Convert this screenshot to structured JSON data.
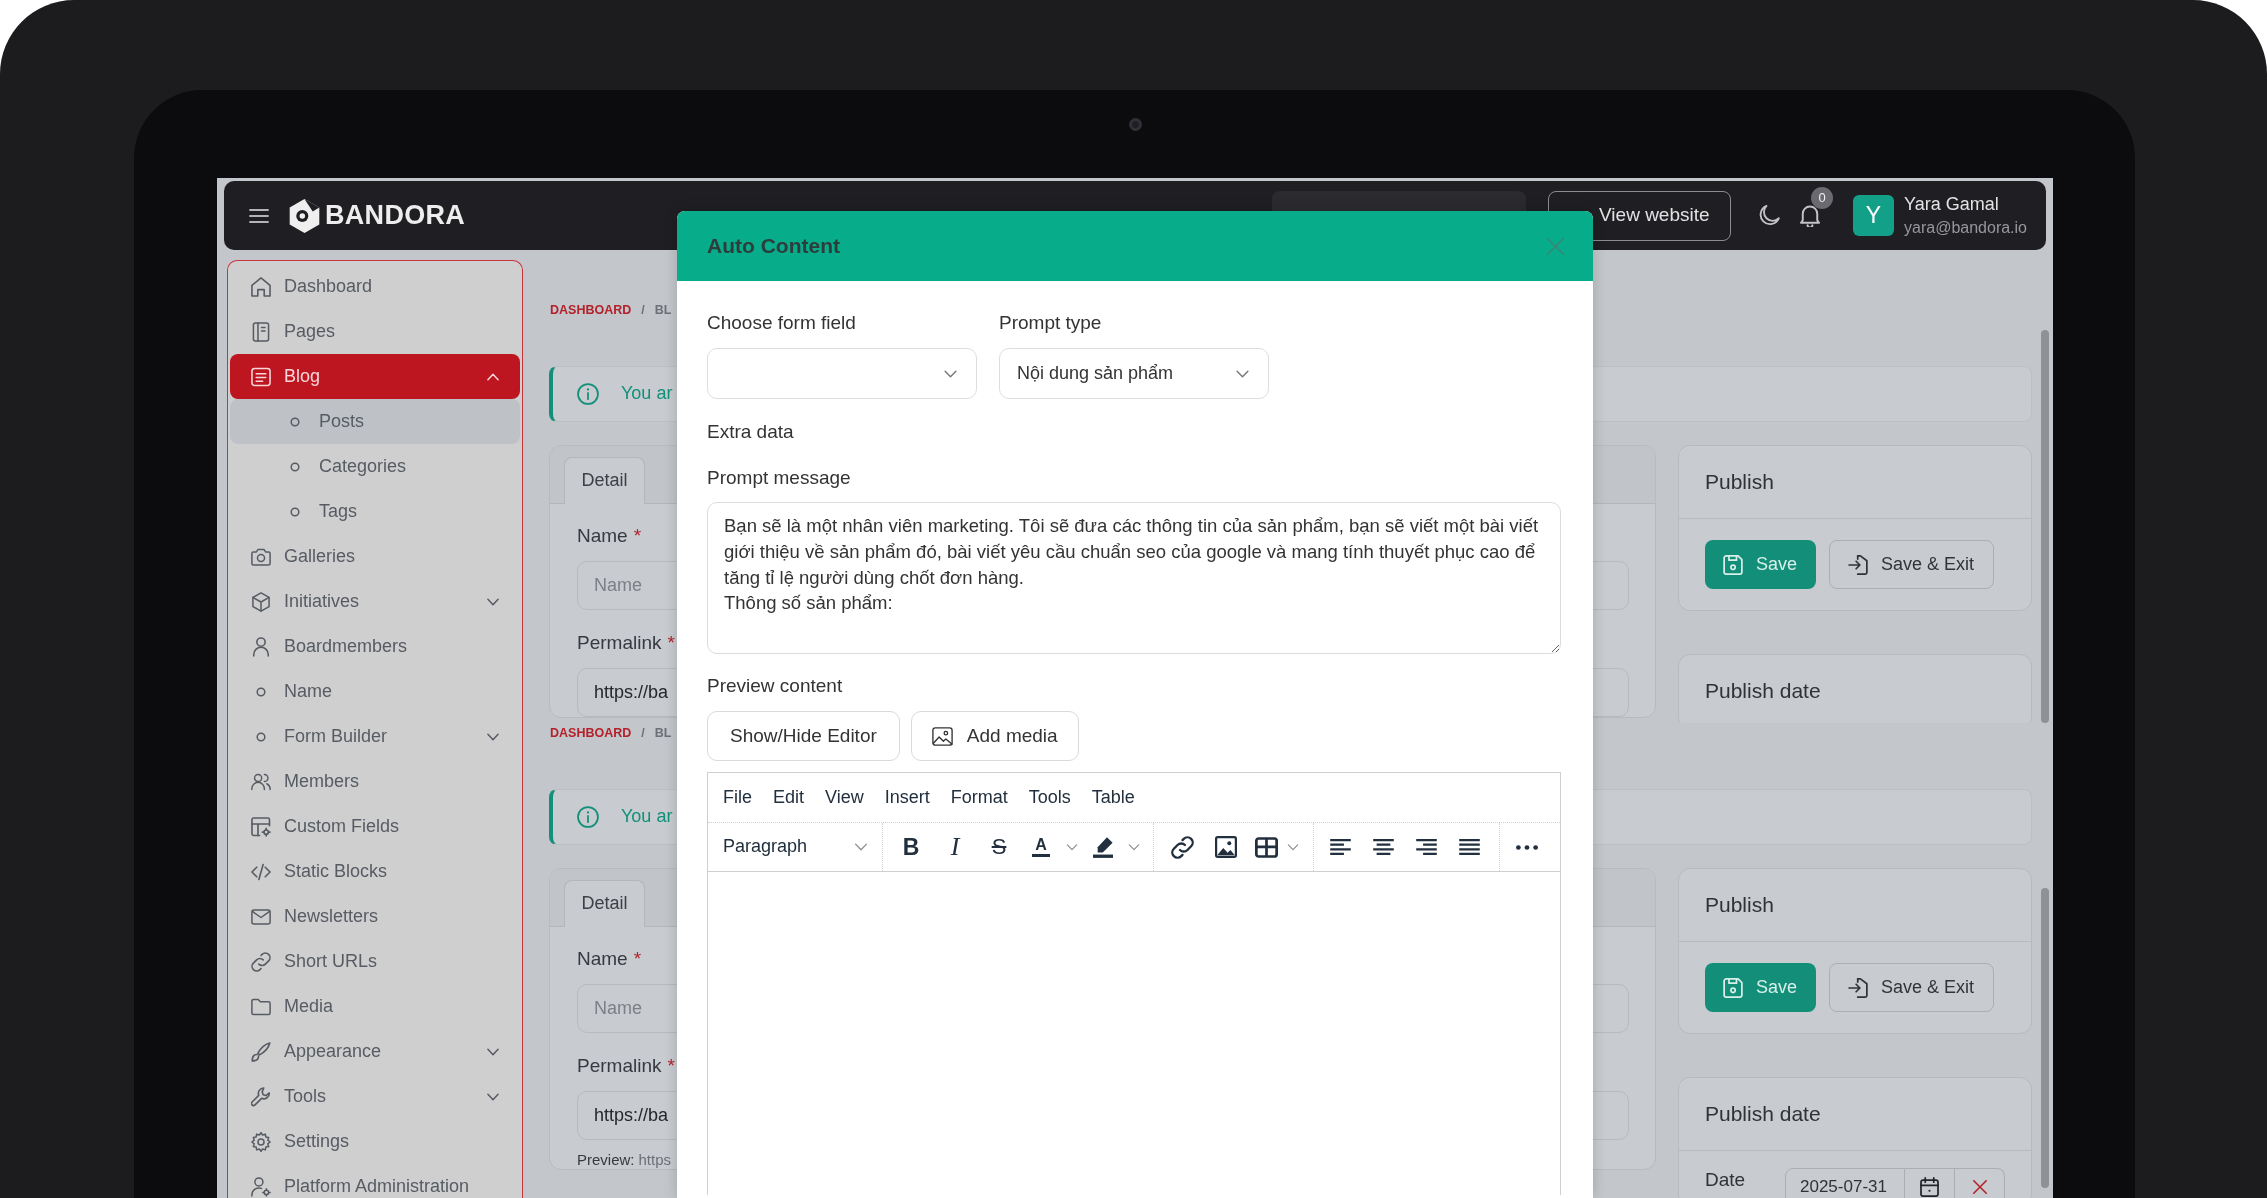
{
  "navbar": {
    "brand": "BANDORA",
    "view_website": "View website",
    "notifications": {
      "count": "0"
    },
    "user": {
      "initial": "Y",
      "name": "Yara Gamal",
      "email": "yara@bandora.io"
    }
  },
  "sidebar": {
    "items": [
      {
        "label": "Dashboard",
        "kind": "link",
        "selected": false
      },
      {
        "label": "Pages",
        "kind": "link",
        "selected": false
      },
      {
        "label": "Blog",
        "kind": "group",
        "selected": true,
        "expanded": true,
        "children": [
          {
            "label": "Posts",
            "selected": true
          },
          {
            "label": "Categories",
            "selected": false
          },
          {
            "label": "Tags",
            "selected": false
          }
        ]
      },
      {
        "label": "Galleries",
        "kind": "link",
        "selected": false
      },
      {
        "label": "Initiatives",
        "kind": "group",
        "selected": false,
        "expanded": false
      },
      {
        "label": "Boardmembers",
        "kind": "link",
        "selected": false
      },
      {
        "label": "Name",
        "kind": "link",
        "selected": false
      },
      {
        "label": "Form Builder",
        "kind": "group",
        "selected": false,
        "expanded": false
      },
      {
        "label": "Members",
        "kind": "link",
        "selected": false
      },
      {
        "label": "Custom Fields",
        "kind": "link",
        "selected": false
      },
      {
        "label": "Static Blocks",
        "kind": "link",
        "selected": false
      },
      {
        "label": "Newsletters",
        "kind": "link",
        "selected": false
      },
      {
        "label": "Short URLs",
        "kind": "link",
        "selected": false
      },
      {
        "label": "Media",
        "kind": "link",
        "selected": false
      },
      {
        "label": "Appearance",
        "kind": "group",
        "selected": false,
        "expanded": false
      },
      {
        "label": "Tools",
        "kind": "group",
        "selected": false,
        "expanded": false
      },
      {
        "label": "Settings",
        "kind": "link",
        "selected": false
      },
      {
        "label": "Platform Administration",
        "kind": "link",
        "selected": false
      }
    ]
  },
  "page_copies": [
    {
      "breadcrumb": {
        "separator": "/",
        "items": [
          {
            "label": "DASHBOARD",
            "kind": "link"
          },
          {
            "label": "BL",
            "kind": "current"
          }
        ]
      },
      "alert": {
        "text": "You ar"
      },
      "tabs": [
        {
          "label": "Detail",
          "selected": true
        }
      ],
      "fields": [
        {
          "label": "Name",
          "required": true,
          "required_mark": "*",
          "placeholder": "Name"
        },
        {
          "label": "Permalink",
          "required": true,
          "required_mark": "*",
          "value": "https://ba"
        }
      ],
      "publish": {
        "title": "Publish",
        "buttons": [
          {
            "label": "Save",
            "kind": "primary"
          },
          {
            "label": "Save & Exit",
            "kind": "secondary"
          }
        ]
      },
      "publish_date": {
        "title": "Publish date"
      }
    },
    {
      "breadcrumb": {
        "separator": "/",
        "items": [
          {
            "label": "DASHBOARD",
            "kind": "link"
          },
          {
            "label": "BL",
            "kind": "current"
          }
        ]
      },
      "alert": {
        "text": "You ar"
      },
      "tabs": [
        {
          "label": "Detail",
          "selected": true
        }
      ],
      "fields": [
        {
          "label": "Name",
          "required": true,
          "required_mark": "*",
          "placeholder": "Name"
        },
        {
          "label": "Permalink",
          "required": true,
          "required_mark": "*",
          "value": "https://ba",
          "preview": {
            "label": "Preview:",
            "url": "https"
          }
        }
      ],
      "publish": {
        "title": "Publish",
        "buttons": [
          {
            "label": "Save",
            "kind": "primary"
          },
          {
            "label": "Save & Exit",
            "kind": "secondary"
          }
        ]
      },
      "publish_date": {
        "title": "Publish date",
        "date": {
          "label": "Date",
          "value": "2025-07-31"
        }
      }
    }
  ],
  "modal": {
    "title": "Auto Content",
    "selects": [
      {
        "label": "Choose form field"
      },
      {
        "label": "Prompt type",
        "value": "Nội dung sản phẩm"
      }
    ],
    "extra_data": {
      "label": "Extra data"
    },
    "prompt": {
      "label": "Prompt message",
      "value": "Bạn sẽ là một nhân viên marketing. Tôi sẽ đưa các thông tin của sản phẩm, bạn sẽ viết một bài viết giới thiệu về sản phẩm đó, bài viết yêu cầu chuẩn seo của google và mang tính thuyết phục cao để tăng tỉ lệ người dùng chốt đơn hàng.\nThông số sản phẩm:"
    },
    "preview": {
      "label": "Preview content",
      "buttons": [
        {
          "label": "Show/Hide Editor",
          "kind": "plain"
        },
        {
          "label": "Add media",
          "kind": "media"
        }
      ]
    },
    "editor": {
      "menu": [
        "File",
        "Edit",
        "View",
        "Insert",
        "Format",
        "Tools",
        "Table"
      ],
      "block_format": "Paragraph",
      "format_buttons": [
        {
          "glyph": "B",
          "kind": "bold"
        },
        {
          "glyph": "I",
          "kind": "italic"
        },
        {
          "glyph": "S",
          "kind": "strikethrough"
        },
        {
          "glyph": "A",
          "kind": "text-color"
        }
      ]
    }
  }
}
